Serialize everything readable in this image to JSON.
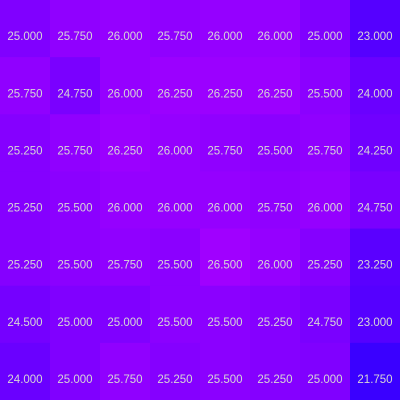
{
  "chart_data": {
    "type": "heatmap",
    "rows": [
      [
        "25.000",
        "25.750",
        "26.000",
        "25.750",
        "26.000",
        "26.000",
        "25.000",
        "23.000"
      ],
      [
        "25.750",
        "24.750",
        "26.000",
        "26.250",
        "26.250",
        "26.250",
        "25.500",
        "24.000"
      ],
      [
        "25.250",
        "25.750",
        "26.250",
        "26.000",
        "25.750",
        "25.500",
        "25.750",
        "24.250"
      ],
      [
        "25.250",
        "25.500",
        "26.000",
        "26.000",
        "26.000",
        "25.750",
        "26.000",
        "24.750"
      ],
      [
        "25.250",
        "25.500",
        "25.750",
        "25.500",
        "26.500",
        "26.000",
        "25.250",
        "23.250"
      ],
      [
        "24.500",
        "25.000",
        "25.000",
        "25.500",
        "25.500",
        "25.250",
        "24.750",
        "23.000"
      ],
      [
        "24.000",
        "25.000",
        "25.750",
        "25.250",
        "25.500",
        "25.250",
        "25.000",
        "21.750"
      ]
    ],
    "color_scale": {
      "low_color": "#3a00ff",
      "high_color": "#a000ff"
    },
    "grid": false,
    "legend": "none"
  }
}
